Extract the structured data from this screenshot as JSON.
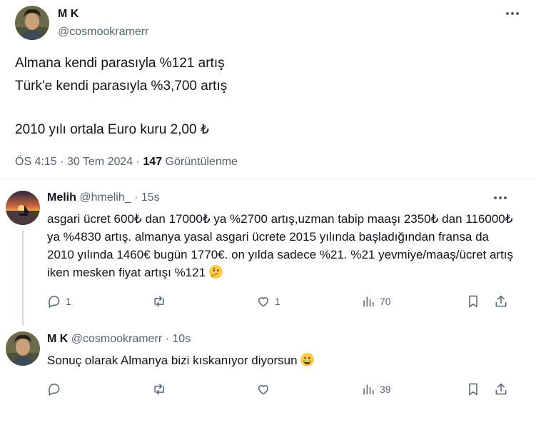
{
  "main_tweet": {
    "name": "M K",
    "handle": "@cosmookramerr",
    "lines": [
      "Almana kendi parasıyla %121 artış",
      "Türk'e kendi parasıyla %3,700 artış",
      "2010 yılı ortala Euro kuru 2,00 ₺"
    ],
    "time": "ÖS 4:15",
    "date": "30 Tem 2024",
    "separator": "·",
    "views": "147",
    "views_label": "Görüntülenme"
  },
  "reply1": {
    "name": "Melih",
    "handle": "@hmelih_",
    "time": "15s",
    "text": "asgari ücret 600₺ dan 17000₺ ya %2700 artış,uzman tabip maaşı 2350₺ dan 116000₺ ya %4830 artış. almanya yasal asgari ücrete 2015 yılında başladığından fransa da 2010 yılında 1460€ bugün 1770€. on yılda sadece %21. %21 yevmiye/maaş/ücret artış iken mesken fiyat artışı %121",
    "emoji": "thinking-face",
    "reply_count": "1",
    "like_count": "1",
    "views": "70"
  },
  "reply2": {
    "name": "M K",
    "handle": "@cosmookramerr",
    "time": "10s",
    "text": "Sonuç olarak Almanya bizi kıskanıyor diyorsun",
    "emoji": "grinning-face",
    "views": "39"
  },
  "colors": {
    "text": "#0f1419",
    "secondary": "#536471",
    "divider": "#eff3f4",
    "thread": "#cfd9de"
  }
}
